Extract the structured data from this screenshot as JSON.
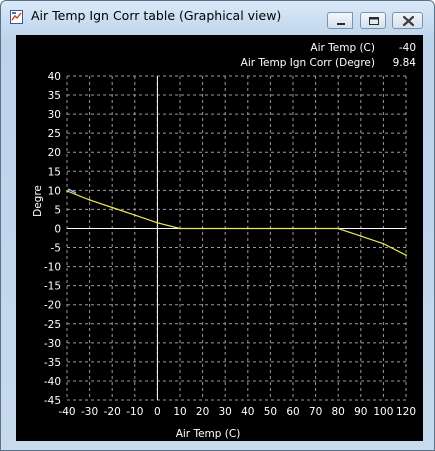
{
  "window": {
    "title": "Air Temp Ign Corr table (Graphical view)"
  },
  "readout": {
    "x_label": "Air Temp (C)",
    "x_value": "-40",
    "y_label": "Air Temp Ign Corr (Degre)",
    "y_value": "9.84"
  },
  "icons": {
    "app": "chart-document-icon",
    "minimize": "minimize-icon",
    "maximize": "maximize-icon",
    "close": "close-icon"
  },
  "colors": {
    "background": "#000000",
    "grid": "#9a9a9a",
    "axis": "#ffffff",
    "curve": "#e8e85a",
    "text": "#ffffff"
  },
  "chart_data": {
    "type": "line",
    "xlabel": "Air Temp (C)",
    "ylabel": "Degre",
    "x_ticks": [
      "-40",
      "-30",
      "-20",
      "-10",
      "0",
      "10",
      "20",
      "30",
      "40",
      "50",
      "60",
      "70",
      "80",
      "90",
      "100",
      "120"
    ],
    "y_ticks": [
      "40",
      "35",
      "30",
      "25",
      "20",
      "15",
      "10",
      "5",
      "0",
      "-5",
      "-10",
      "-15",
      "-20",
      "-25",
      "-30",
      "-35",
      "-40",
      "-45"
    ],
    "x_tick_values": [
      -40,
      -30,
      -20,
      -10,
      0,
      10,
      20,
      30,
      40,
      50,
      60,
      70,
      80,
      90,
      100,
      120
    ],
    "ylim": [
      -45,
      40
    ],
    "grid": true,
    "series": [
      {
        "x": [
          -40,
          -30,
          -20,
          -10,
          0,
          10,
          20,
          30,
          40,
          50,
          60,
          70,
          80,
          90,
          100,
          120
        ],
        "y": [
          9.84,
          7.5,
          5.5,
          3.5,
          1.5,
          0,
          0,
          0,
          0,
          0,
          0,
          0,
          0,
          -2,
          -4,
          -7
        ]
      }
    ],
    "cursor": {
      "x": -40,
      "y": 9.84
    }
  }
}
